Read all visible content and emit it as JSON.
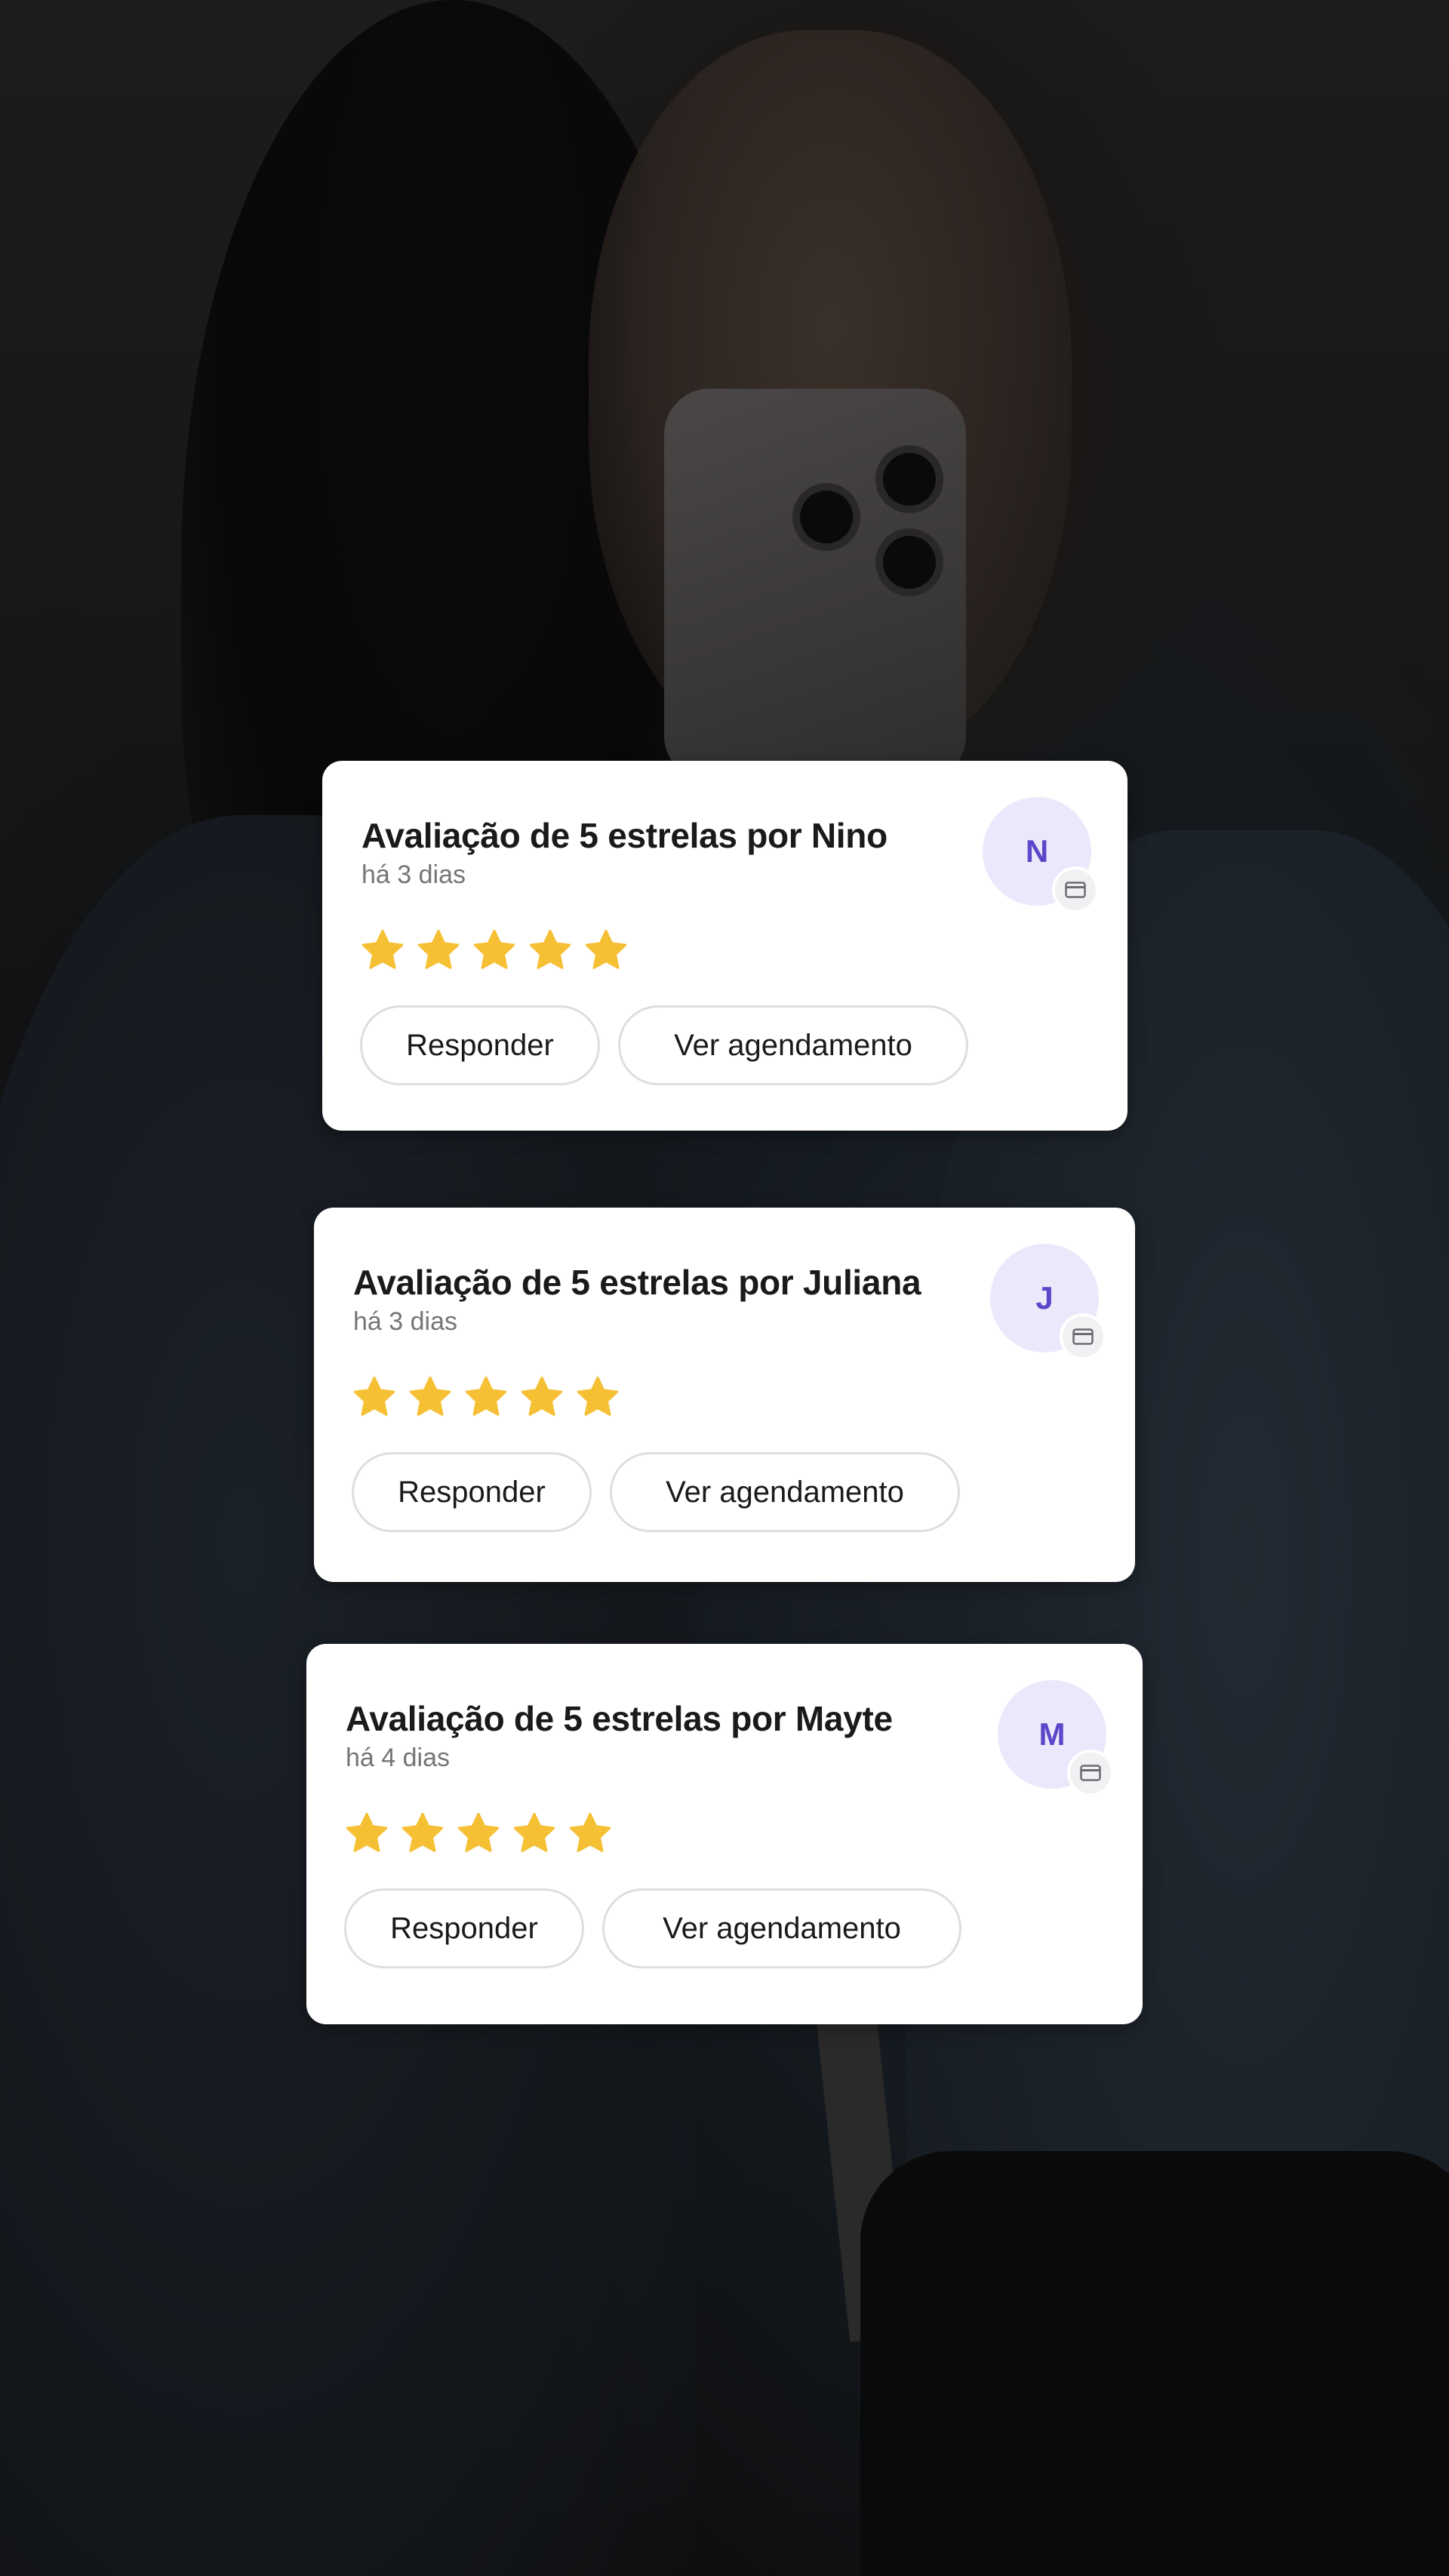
{
  "reviews": [
    {
      "title": "Avaliação de 5 estrelas por Nino",
      "time": "há 3 dias",
      "initial": "N",
      "rating": 5,
      "reply_label": "Responder",
      "view_label": "Ver agendamento"
    },
    {
      "title": "Avaliação de 5 estrelas por Juliana",
      "time": "há 3 dias",
      "initial": "J",
      "rating": 5,
      "reply_label": "Responder",
      "view_label": "Ver agendamento"
    },
    {
      "title": "Avaliação de 5 estrelas por Mayte",
      "time": "há 4 dias",
      "initial": "M",
      "rating": 5,
      "reply_label": "Responder",
      "view_label": "Ver agendamento"
    }
  ],
  "colors": {
    "star": "#f6c035",
    "avatar_bg": "#ece8fb",
    "avatar_text": "#5b47c9",
    "card_bg": "#ffffff"
  },
  "icons": {
    "star": "star-icon",
    "badge": "calendar-card-icon"
  }
}
